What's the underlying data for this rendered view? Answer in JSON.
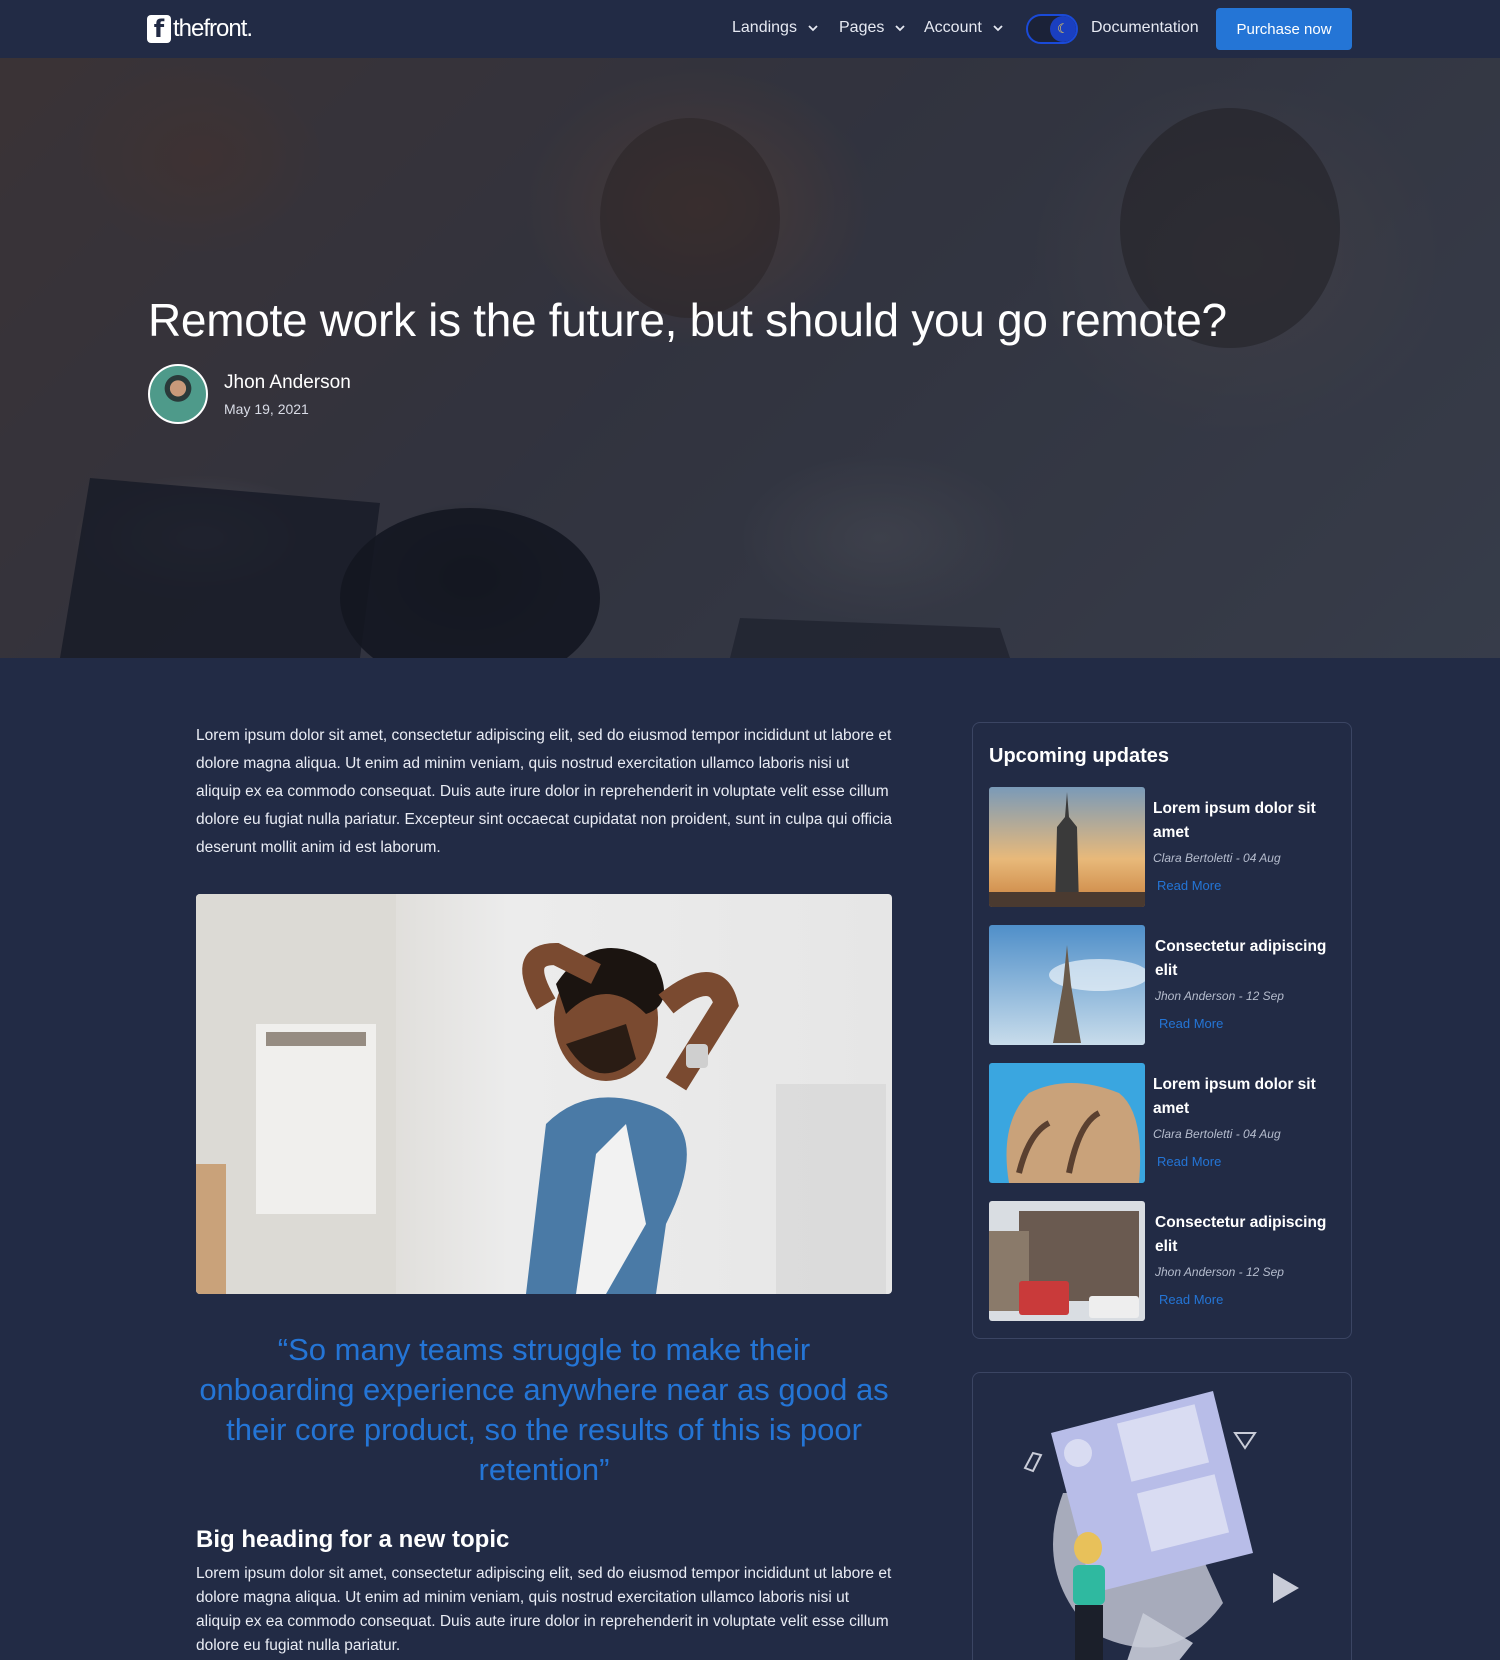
{
  "nav": {
    "logo_text": "thefront.",
    "logo_letter": "f",
    "items": [
      {
        "label": "Landings"
      },
      {
        "label": "Pages"
      },
      {
        "label": "Account"
      }
    ],
    "documentation": "Documentation",
    "purchase": "Purchase now",
    "toggle_icon": "moon-icon"
  },
  "hero": {
    "title": "Remote work is the future, but should you go remote?",
    "author": "Jhon Anderson",
    "date": "May 19, 2021"
  },
  "article": {
    "intro": "Lorem ipsum dolor sit amet, consectetur adipiscing elit, sed do eiusmod tempor incididunt ut labore et dolore magna aliqua. Ut enim ad minim veniam, quis nostrud exercitation ullamco laboris nisi ut aliquip ex ea commodo consequat. Duis aute irure dolor in reprehenderit in voluptate velit esse cillum dolore eu fugiat nulla pariatur. Excepteur sint occaecat cupidatat non proident, sunt in culpa qui officia deserunt mollit anim id est laborum.",
    "quote": "“So many teams struggle to make their onboarding experience anywhere near as good as their core product, so the results of this is poor retention”",
    "heading": "Big heading for a new topic",
    "body": "Lorem ipsum dolor sit amet, consectetur adipiscing elit, sed do eiusmod tempor incididunt ut labore et dolore magna aliqua. Ut enim ad minim veniam, quis nostrud exercitation ullamco laboris nisi ut aliquip ex ea commodo consequat. Duis aute irure dolor in reprehenderit in voluptate velit esse cillum dolore eu fugiat nulla pariatur."
  },
  "sidebar": {
    "title": "Upcoming updates",
    "updates": [
      {
        "title": "Lorem ipsum dolor sit amet",
        "meta": "Clara Bertoletti - 04 Aug",
        "link": "Read More"
      },
      {
        "title": "Consectetur adipiscing elit",
        "meta": "Jhon Anderson - 12 Sep",
        "link": "Read More"
      },
      {
        "title": "Lorem ipsum dolor sit amet",
        "meta": "Clara Bertoletti - 04 Aug",
        "link": "Read More"
      },
      {
        "title": "Consectetur adipiscing elit",
        "meta": "Jhon Anderson - 12 Sep",
        "link": "Read More"
      }
    ]
  },
  "colors": {
    "background": "#222b45",
    "accent": "#2475d6"
  }
}
